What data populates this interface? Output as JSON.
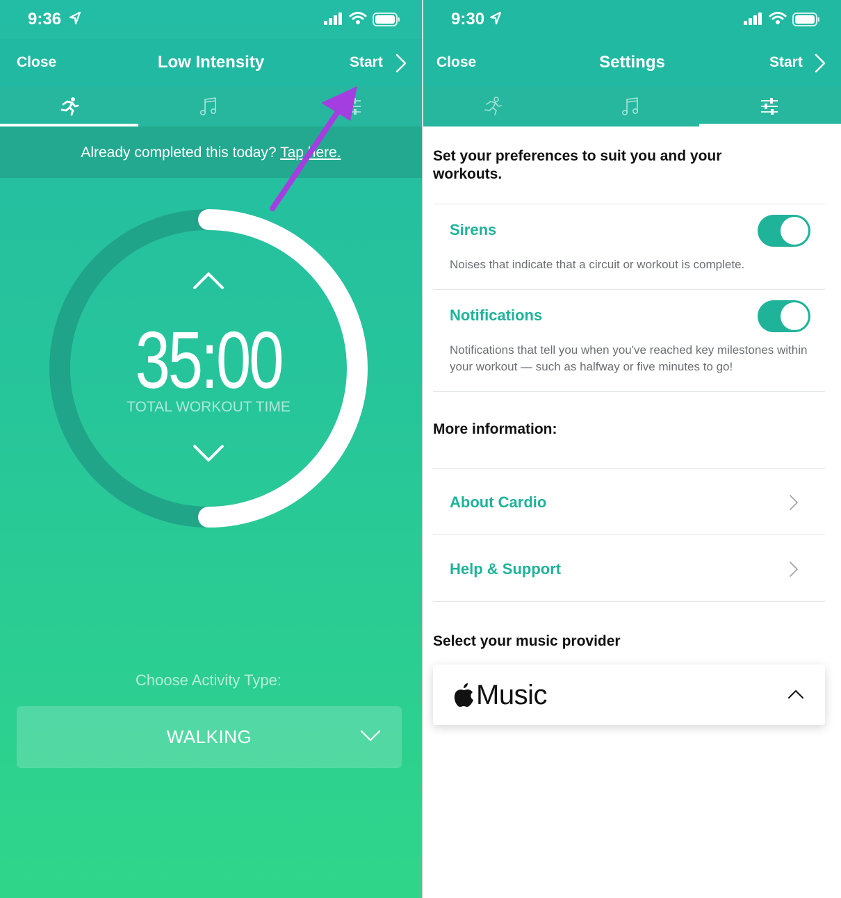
{
  "left_screen": {
    "status": {
      "time": "9:36"
    },
    "nav": {
      "close": "Close",
      "title": "Low Intensity",
      "start": "Start"
    },
    "tabs": [
      {
        "icon": "running-icon",
        "active": true
      },
      {
        "icon": "music-note-icon",
        "active": false
      },
      {
        "icon": "sliders-icon",
        "active": false
      }
    ],
    "banner": {
      "text": "Already completed this today? ",
      "link": "Tap here."
    },
    "timer": {
      "value": "35:00",
      "label": "TOTAL WORKOUT TIME"
    },
    "activity": {
      "prompt": "Choose Activity Type:",
      "selected": "WALKING"
    },
    "annotation_arrow_color": "#a43ee0"
  },
  "right_screen": {
    "status": {
      "time": "9:30"
    },
    "nav": {
      "close": "Close",
      "title": "Settings",
      "start": "Start"
    },
    "tabs": [
      {
        "icon": "running-icon",
        "active": false
      },
      {
        "icon": "music-note-icon",
        "active": false
      },
      {
        "icon": "sliders-icon",
        "active": true
      }
    ],
    "intro": "Set your preferences to suit you and your workouts.",
    "settings": [
      {
        "title": "Sirens",
        "description": "Noises that indicate that a circuit or workout is complete.",
        "enabled": true
      },
      {
        "title": "Notifications",
        "description": "Notifications that tell you when you've reached key milestones within your workout — such as halfway or five minutes to go!",
        "enabled": true
      }
    ],
    "more_info": {
      "heading": "More information:",
      "links": [
        {
          "label": "About Cardio"
        },
        {
          "label": "Help & Support"
        }
      ]
    },
    "music": {
      "heading": "Select your music provider",
      "provider": "Music"
    }
  },
  "colors": {
    "teal": "#1fb39a",
    "header": "#22b9a2",
    "accent_purple": "#a43ee0"
  }
}
